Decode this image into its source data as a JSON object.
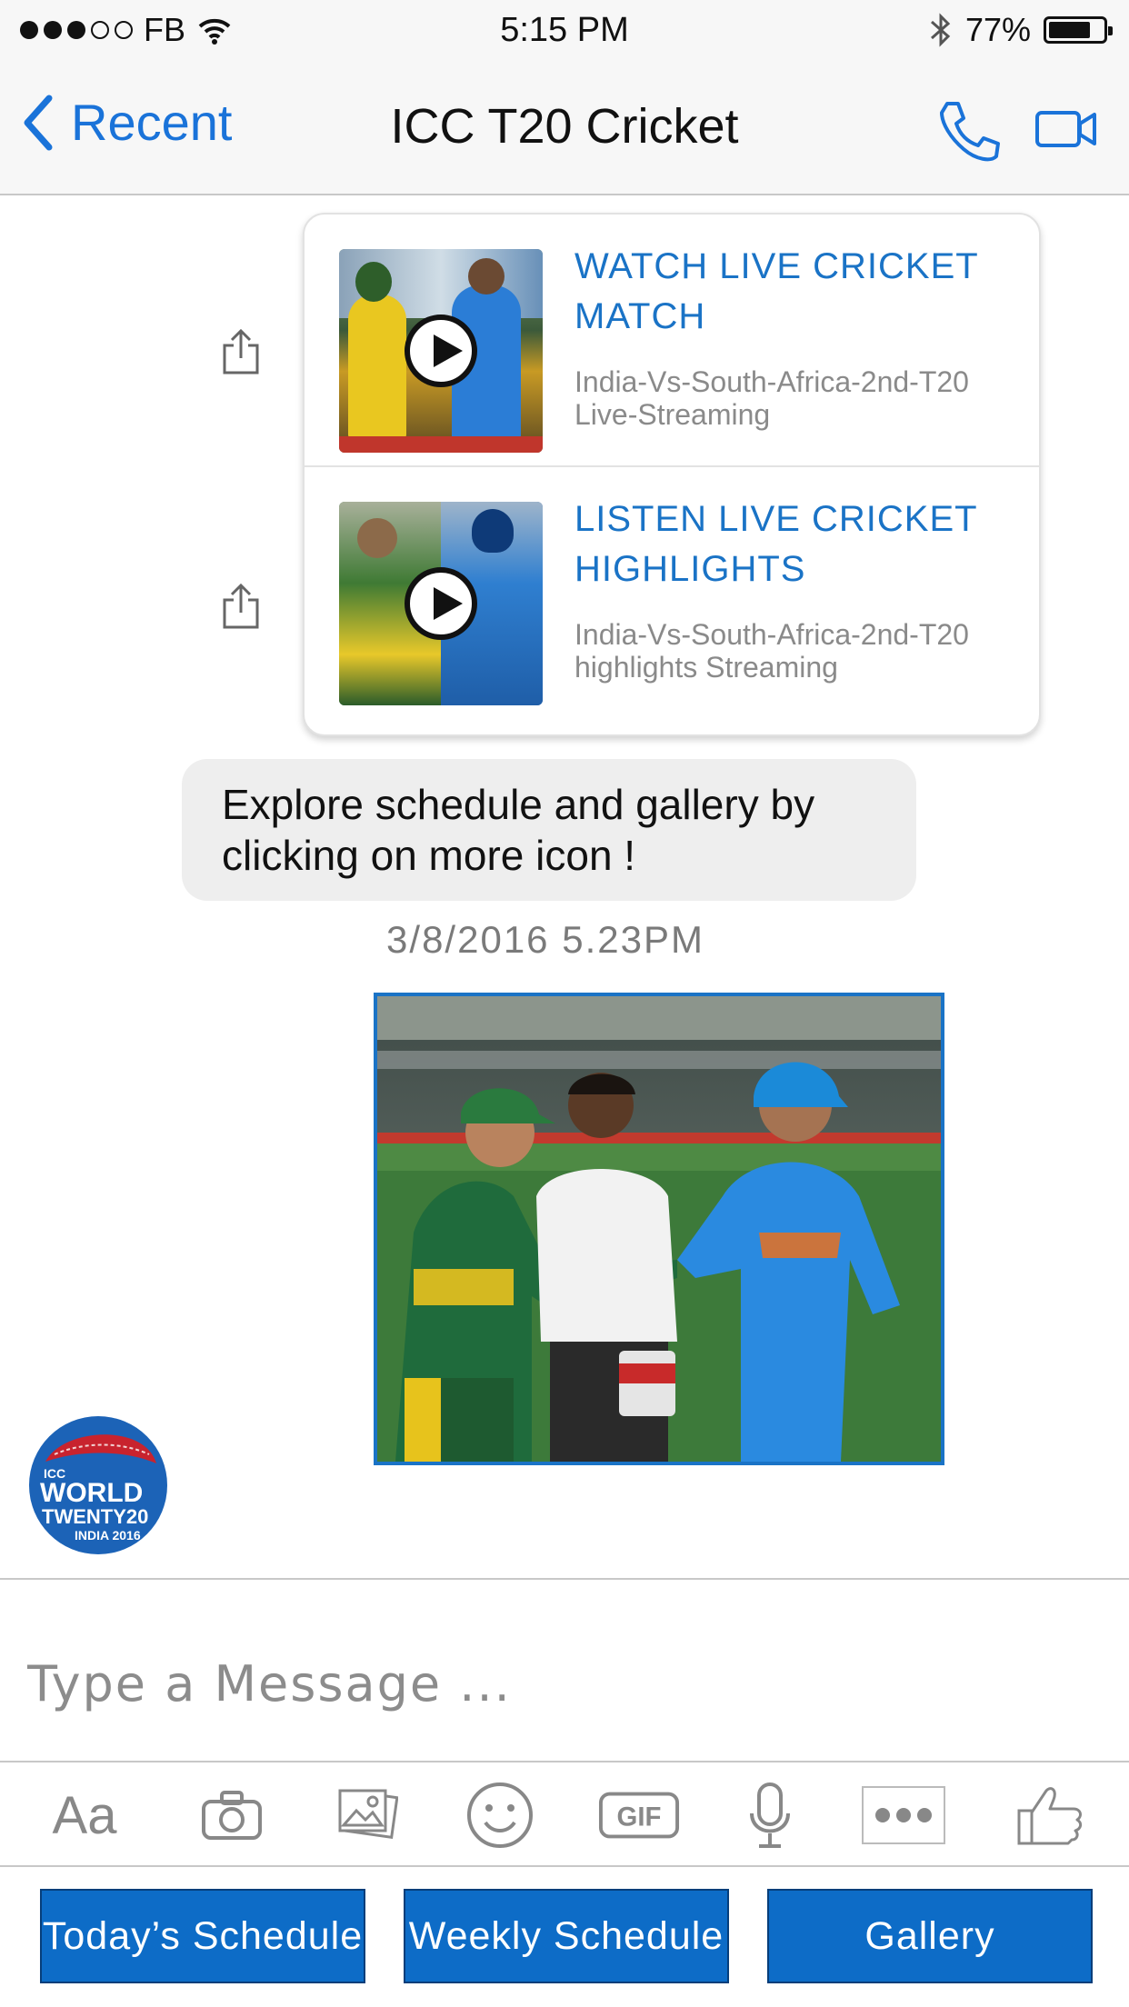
{
  "status_bar": {
    "carrier": "FB",
    "time": "5:15 PM",
    "battery_percent": "77%",
    "battery_level": 0.77,
    "signal_bars_filled": 3,
    "signal_bars_total": 5
  },
  "nav": {
    "back_label": "Recent",
    "title": "ICC T20 Cricket",
    "call_icon": "phone-icon",
    "video_icon": "video-camera-icon"
  },
  "cards": [
    {
      "title": "WATCH LIVE CRICKET MATCH",
      "subtitle": "India-Vs-South-Africa-2nd-T20 Live-Streaming"
    },
    {
      "title": "LISTEN LIVE CRICKET HIGHLIGHTS",
      "subtitle": "India-Vs-South-Africa-2nd-T20 highlights Streaming"
    }
  ],
  "bubble": {
    "text": "Explore schedule and gallery by clicking on more icon !"
  },
  "timestamp": "3/8/2016  5.23PM",
  "logo": {
    "line1": "ICC",
    "line2": "WORLD",
    "line3": "TWENTY20",
    "line4": "INDIA 2016"
  },
  "composer": {
    "placeholder": "Type a Message ...",
    "value": ""
  },
  "toolbar": {
    "text_label": "Aa",
    "gif_label": "GIF",
    "icons": [
      "text-format-icon",
      "camera-icon",
      "photos-icon",
      "emoji-icon",
      "gif-icon",
      "microphone-icon",
      "more-icon",
      "thumbs-up-icon"
    ]
  },
  "quick_replies": [
    "Today’s Schedule",
    "Weekly Schedule",
    "Gallery"
  ],
  "colors": {
    "accent": "#1a73c6",
    "button": "#0d6cc7",
    "bar": "#f7f7f7"
  }
}
